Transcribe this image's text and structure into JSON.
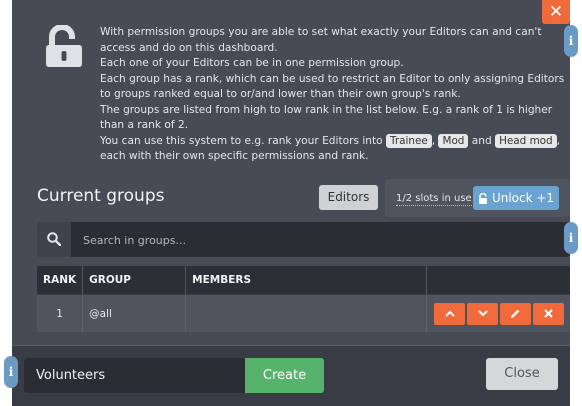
{
  "dialog": {
    "close_icon": "close-x-icon",
    "info_icon": "info-i-icon",
    "lock_icon": "unlocked-padlock-icon"
  },
  "intro": {
    "line1": "With permission groups you are able to set what exactly your Editors can and can't access and do on this dashboard.",
    "line2": "Each one of your Editors can be in one permission group.",
    "line3": "Each group has a rank, which can be used to restrict an Editor to only assigning Editors to groups ranked equal to or/and lower than their own group's rank.",
    "line4": "The groups are listed from high to low rank in the list below. E.g. a rank of 1 is higher than a rank of 2.",
    "line5_before": "You can use this system to e.g. rank your Editors into",
    "pill1": "Trainee",
    "pill2": "Mod",
    "between": "and",
    "pill3": "Head mod",
    "line5_after": ", each with their own specific permissions and rank."
  },
  "groups_section": {
    "heading": "Current groups",
    "editors_button": "Editors",
    "slots_text": "1/2 slots in use",
    "unlock_button": "Unlock +1"
  },
  "search": {
    "placeholder": "Search in groups...",
    "value": ""
  },
  "table": {
    "headers": [
      "RANK",
      "GROUP",
      "MEMBERS",
      ""
    ],
    "rows": [
      {
        "rank": "1",
        "group": "@all",
        "members": ""
      }
    ]
  },
  "footer": {
    "new_group_value": "Volunteers",
    "create_button": "Create",
    "close_button": "Close"
  },
  "colors": {
    "accent_orange": "#f06a3c",
    "accent_blue": "#6aa2d0",
    "create_green": "#57b36c",
    "panel": "#474b55"
  }
}
